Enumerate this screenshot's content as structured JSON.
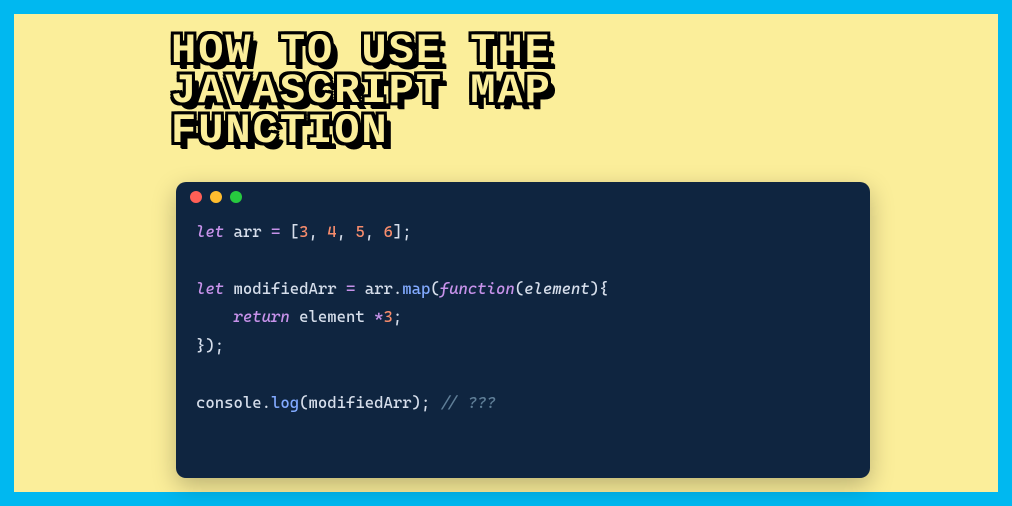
{
  "title": "HOW TO USE THE\nJAVASCRIPT MAP\nFUNCTION",
  "colors": {
    "frame": "#00b8f0",
    "canvas": "#fbee9a",
    "window_bg": "#0f2540",
    "dot_red": "#ff5f56",
    "dot_yellow": "#ffbd2e",
    "dot_green": "#27c93f"
  },
  "code": {
    "l1": {
      "let": "let",
      "sp": " ",
      "arr": "arr",
      "eq": " = ",
      "ob": "[",
      "n1": "3",
      "c": ", ",
      "n2": "4",
      "n3": "5",
      "n4": "6",
      "cb": "];"
    },
    "blank": "",
    "l3": {
      "let": "let",
      "sp": " ",
      "mod": "modifiedArr",
      "eq": " = ",
      "arr": "arr",
      "dot": ".",
      "map": "map",
      "op": "(",
      "func": "function",
      "op2": "(",
      "param": "element",
      "cp2": ")",
      "brace": "{"
    },
    "l4": {
      "indent": "    ",
      "ret": "return",
      "sp": " ",
      "el": "element",
      "sp2": " ",
      "star": "*",
      "n": "3",
      "semi": ";"
    },
    "l5": {
      "close": "});"
    },
    "l7": {
      "cons": "console",
      "dot": ".",
      "log": "log",
      "op": "(",
      "arg": "modifiedArr",
      "cp": "); ",
      "com": "// ???"
    }
  }
}
